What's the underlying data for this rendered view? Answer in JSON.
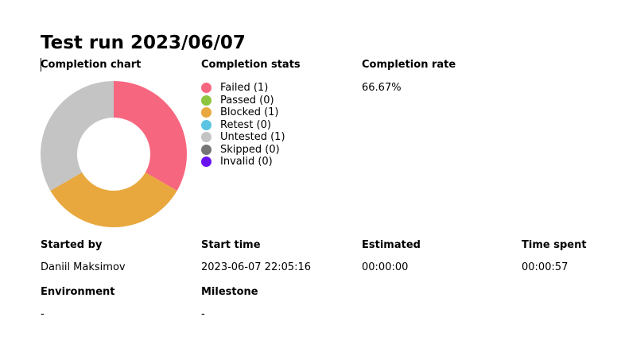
{
  "run": {
    "title": "Test run 2023/06/07"
  },
  "sections": {
    "completion_chart": "Completion chart",
    "completion_stats": "Completion stats",
    "completion_rate": "Completion rate"
  },
  "completion_rate": "66.67%",
  "colors": {
    "failed": "#f7667f",
    "passed": "#8dc440",
    "blocked": "#e8a83e",
    "retest": "#5bc4e2",
    "untested": "#c4c4c4",
    "skipped": "#757575",
    "invalid": "#6a11f2"
  },
  "stats": [
    {
      "key": "failed",
      "label": "Failed (1)",
      "count": 1
    },
    {
      "key": "passed",
      "label": "Passed (0)",
      "count": 0
    },
    {
      "key": "blocked",
      "label": "Blocked (1)",
      "count": 1
    },
    {
      "key": "retest",
      "label": "Retest (0)",
      "count": 0
    },
    {
      "key": "untested",
      "label": "Untested (1)",
      "count": 1
    },
    {
      "key": "skipped",
      "label": "Skipped (0)",
      "count": 0
    },
    {
      "key": "invalid",
      "label": "Invalid (0)",
      "count": 0
    }
  ],
  "details": {
    "started_by_label": "Started by",
    "started_by": "Daniil Maksimov",
    "start_time_label": "Start time",
    "start_time": "2023-06-07 22:05:16",
    "estimated_label": "Estimated",
    "estimated": "00:00:00",
    "time_spent_label": "Time spent",
    "time_spent": "00:00:57",
    "environment_label": "Environment",
    "environment": "-",
    "milestone_label": "Milestone",
    "milestone": "-"
  }
}
